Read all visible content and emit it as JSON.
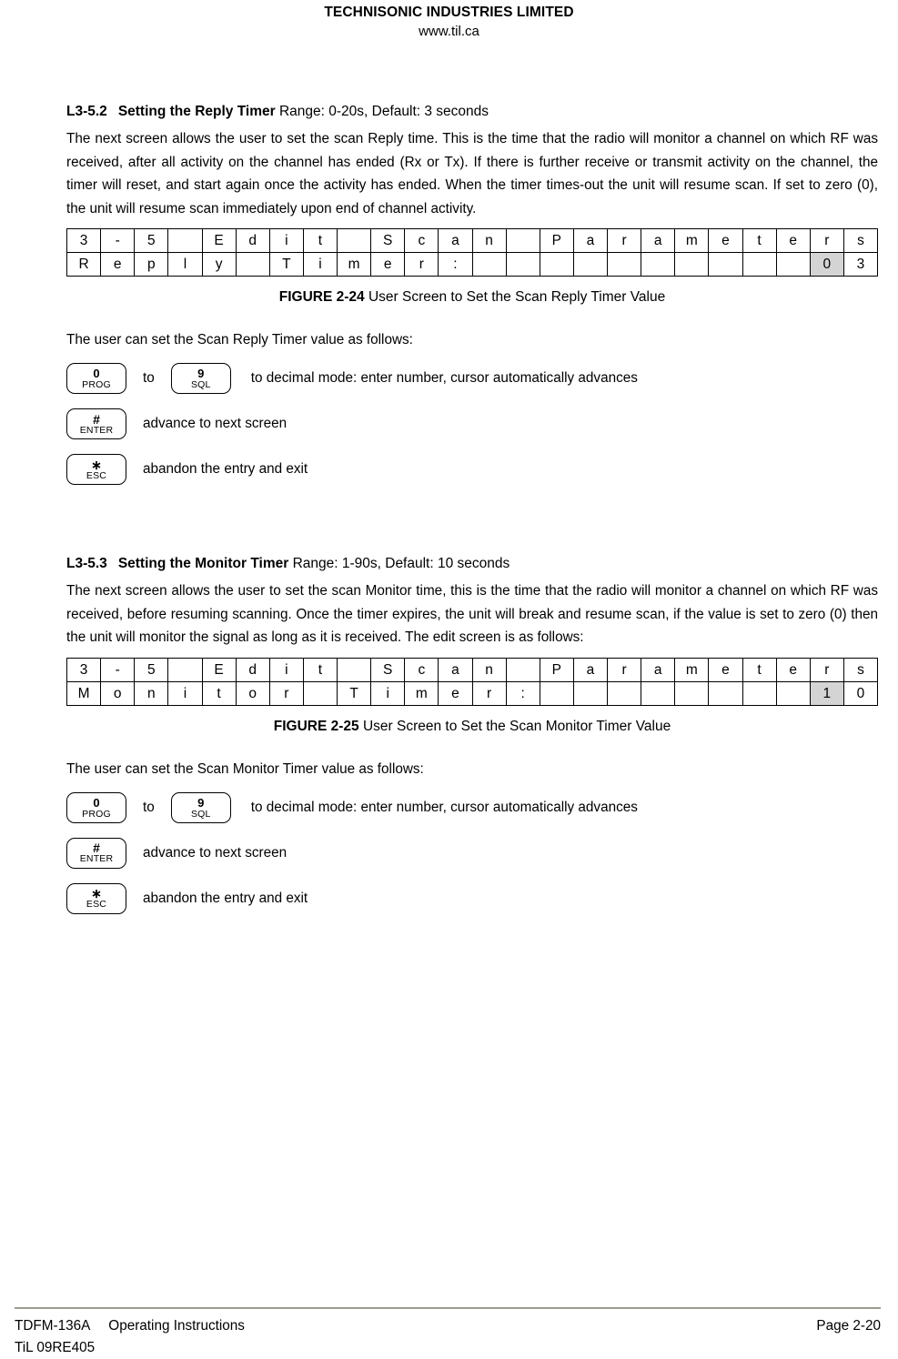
{
  "header": {
    "company": "TECHNISONIC INDUSTRIES LIMITED",
    "website": "www.til.ca"
  },
  "sections": [
    {
      "number": "L3-5.2",
      "title": "Setting the Reply Timer",
      "range": " Range: 0-20s, Default: 3 seconds",
      "body": "The next screen allows the user to set the scan Reply time. This is the time that the radio will monitor a channel on which RF was received, after all activity on the channel has ended (Rx or Tx). If there is further receive or transmit activity on the channel, the timer will reset, and start again once the activity has ended. When the timer times-out the unit will resume scan. If set to zero (0), the unit will resume scan immediately upon end of channel activity.",
      "figure": {
        "label": "FIGURE 2-24",
        "caption": " User Screen to Set the Scan Reply Timer Value",
        "row1": [
          "3",
          "-",
          "5",
          "",
          "E",
          "d",
          "i",
          "t",
          "",
          "S",
          "c",
          "a",
          "n",
          "",
          "P",
          "a",
          "r",
          "a",
          "m",
          "e",
          "t",
          "e",
          "r",
          "s"
        ],
        "row2": [
          "R",
          "e",
          "p",
          "l",
          "y",
          "",
          "T",
          "i",
          "m",
          "e",
          "r",
          ":",
          "",
          "",
          "",
          "",
          "",
          "",
          "",
          "",
          "",
          "",
          "0",
          "3"
        ],
        "row2_shaded": [
          22
        ]
      },
      "lead_in": "The user can set the Scan Reply Timer value as follows:",
      "keys": [
        {
          "key_a": {
            "top": "0",
            "bottom": "PROG"
          },
          "word": "to",
          "key_b": {
            "top": "9",
            "bottom": "SQL"
          },
          "text": "to decimal mode: enter number, cursor automatically advances"
        },
        {
          "key_a": {
            "top": "#",
            "bottom": "ENTER"
          },
          "text": "advance to next screen"
        },
        {
          "key_a": {
            "top": "∗",
            "bottom": "ESC"
          },
          "text": "abandon the entry and exit"
        }
      ]
    },
    {
      "number": "L3-5.3",
      "title": "Setting the Monitor Timer",
      "range": " Range: 1-90s, Default: 10 seconds",
      "body": "The next screen allows the user to set the scan Monitor time, this is the time that the radio will monitor a channel on which RF was received, before resuming scanning. Once the timer expires, the unit will break and resume scan, if the value is set to zero (0) then the unit will monitor the signal as long as it is received. The edit screen is as follows:",
      "figure": {
        "label": "FIGURE 2-25",
        "caption": " User Screen to Set the Scan Monitor Timer Value",
        "row1": [
          "3",
          "-",
          "5",
          "",
          "E",
          "d",
          "i",
          "t",
          "",
          "S",
          "c",
          "a",
          "n",
          "",
          "P",
          "a",
          "r",
          "a",
          "m",
          "e",
          "t",
          "e",
          "r",
          "s"
        ],
        "row2": [
          "M",
          "o",
          "n",
          "i",
          "t",
          "o",
          "r",
          "",
          "T",
          "i",
          "m",
          "e",
          "r",
          ":",
          "",
          "",
          "",
          "",
          "",
          "",
          "",
          "",
          "1",
          "0"
        ],
        "row2_shaded": [
          22
        ]
      },
      "lead_in": "The user can set the Scan Monitor Timer value as follows:",
      "keys": [
        {
          "key_a": {
            "top": "0",
            "bottom": "PROG"
          },
          "word": "to",
          "key_b": {
            "top": "9",
            "bottom": "SQL"
          },
          "text": "to decimal mode: enter number, cursor automatically advances"
        },
        {
          "key_a": {
            "top": "#",
            "bottom": "ENTER"
          },
          "text": "advance to next screen"
        },
        {
          "key_a": {
            "top": "∗",
            "bottom": "ESC"
          },
          "text": "abandon the entry and exit"
        }
      ]
    }
  ],
  "footer": {
    "model": "TDFM-136A",
    "doc_type": "Operating Instructions",
    "page": "Page 2-20",
    "revision": "TiL 09RE405"
  },
  "colors": {
    "shade": "#d4d4d4",
    "rule": "#9b9b8e",
    "text": "#000000"
  }
}
